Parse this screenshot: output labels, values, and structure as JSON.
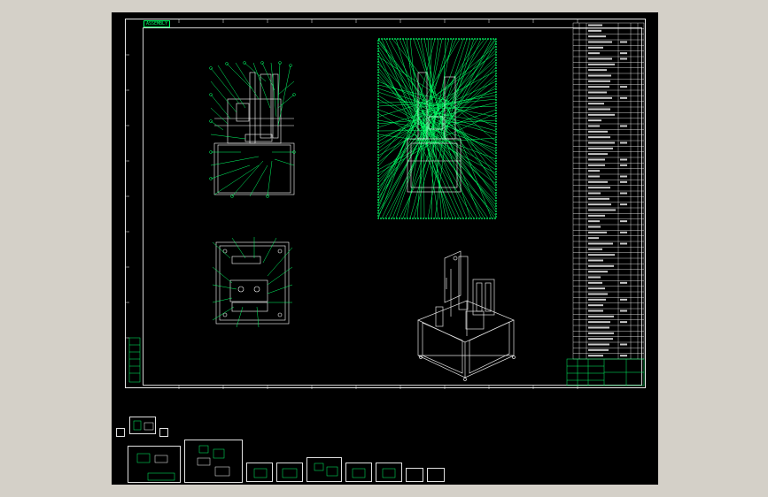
{
  "drawing": {
    "title_tag": "ASSEMBLY",
    "border_color": "#e8e8e8",
    "line_color": "#00ff66",
    "text_color": "#ffffff",
    "background": "#000000"
  },
  "views": [
    {
      "name": "front-view"
    },
    {
      "name": "annotated-view"
    },
    {
      "name": "top-view"
    },
    {
      "name": "isometric-view"
    }
  ],
  "bom_table": {
    "rows": 60
  },
  "thumbnails": [
    {
      "name": "sheet-1"
    },
    {
      "name": "sheet-2"
    },
    {
      "name": "sheet-3"
    },
    {
      "name": "sheet-4"
    },
    {
      "name": "sheet-5"
    },
    {
      "name": "sheet-6"
    },
    {
      "name": "sheet-7"
    },
    {
      "name": "sheet-8"
    },
    {
      "name": "sheet-9"
    },
    {
      "name": "sheet-10"
    },
    {
      "name": "sheet-11"
    }
  ]
}
